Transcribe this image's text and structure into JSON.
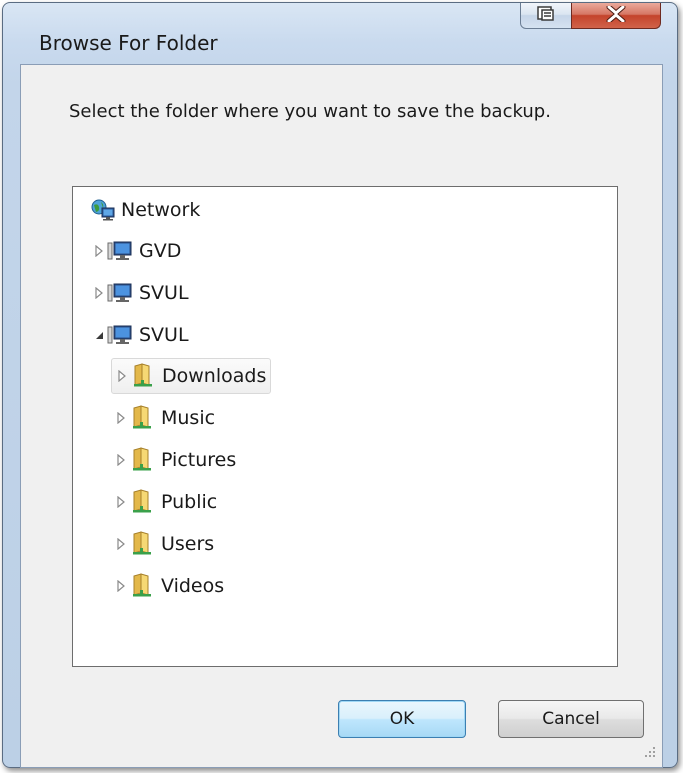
{
  "window": {
    "title": "Browse For Folder",
    "buttons": {
      "help_icon": "context-help-icon",
      "close_icon": "close-x-icon"
    }
  },
  "prompt": "Select the folder where you want to save the backup.",
  "tree": {
    "root": {
      "label": "Network",
      "icon": "network-icon"
    },
    "computers": [
      {
        "label": "GVD",
        "expanded": false,
        "icon": "computer-icon"
      },
      {
        "label": "SVUL",
        "expanded": false,
        "icon": "computer-icon"
      },
      {
        "label": "SVUL",
        "expanded": true,
        "icon": "computer-icon"
      }
    ],
    "folders": [
      {
        "label": "Downloads",
        "selected": true,
        "icon": "shared-folder-icon"
      },
      {
        "label": "Music",
        "selected": false,
        "icon": "shared-folder-icon"
      },
      {
        "label": "Pictures",
        "selected": false,
        "icon": "shared-folder-icon"
      },
      {
        "label": "Public",
        "selected": false,
        "icon": "shared-folder-icon"
      },
      {
        "label": "Users",
        "selected": false,
        "icon": "shared-folder-icon"
      },
      {
        "label": "Videos",
        "selected": false,
        "icon": "shared-folder-icon"
      }
    ]
  },
  "actions": {
    "ok_label": "OK",
    "cancel_label": "Cancel"
  },
  "colors": {
    "frame": "#c3d5ea",
    "close_button": "#c4432b",
    "default_button_border": "#3c7fb1"
  }
}
